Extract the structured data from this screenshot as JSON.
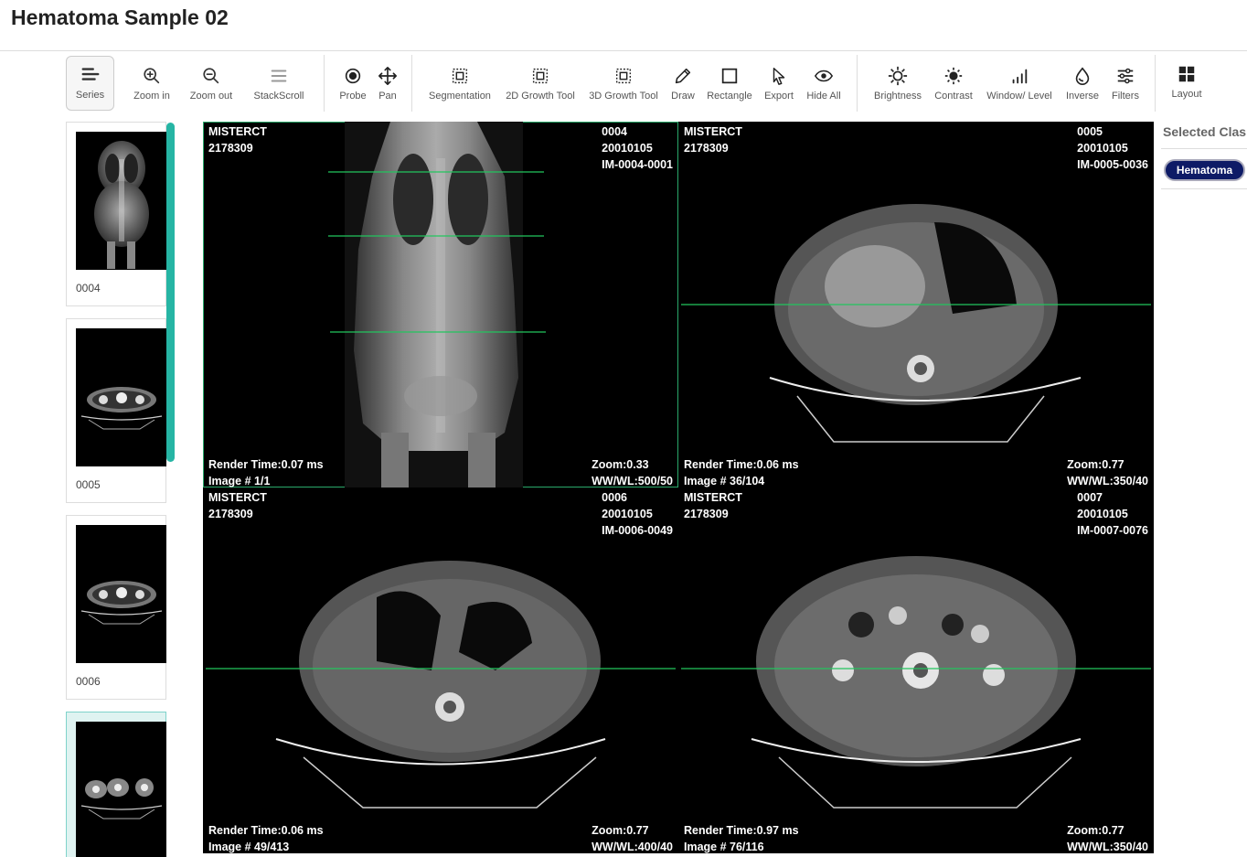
{
  "page": {
    "title": "Hematoma Sample 02"
  },
  "toolbar": {
    "series": "Series",
    "zoom_in": "Zoom in",
    "zoom_out": "Zoom out",
    "stackscroll": "StackScroll",
    "probe": "Probe",
    "pan": "Pan",
    "segmentation": "Segmentation",
    "growth_2d": "2D Growth Tool",
    "growth_3d": "3D Growth Tool",
    "draw": "Draw",
    "rectangle": "Rectangle",
    "export": "Export",
    "hide_all": "Hide All",
    "brightness": "Brightness",
    "contrast": "Contrast",
    "window_level": "Window/ Level",
    "inverse": "Inverse",
    "filters": "Filters",
    "layout": "Layout"
  },
  "thumbnails": [
    {
      "label": "0004",
      "active": false
    },
    {
      "label": "0005",
      "active": false
    },
    {
      "label": "0006",
      "active": false
    },
    {
      "label": "",
      "active": true
    }
  ],
  "viewports": [
    {
      "name": "MISTERCT",
      "id": "2178309",
      "series": "0004",
      "date": "20010105",
      "image_id": "IM-0004-0001",
      "render": "Render Time:0.07 ms",
      "image_num": "Image # 1/1",
      "zoom": "Zoom:0.33",
      "wwwl": "WW/WL:500/50"
    },
    {
      "name": "MISTERCT",
      "id": "2178309",
      "series": "0005",
      "date": "20010105",
      "image_id": "IM-0005-0036",
      "render": "Render Time:0.06 ms",
      "image_num": "Image # 36/104",
      "zoom": "Zoom:0.77",
      "wwwl": "WW/WL:350/40"
    },
    {
      "name": "MISTERCT",
      "id": "2178309",
      "series": "0006",
      "date": "20010105",
      "image_id": "IM-0006-0049",
      "render": "Render Time:0.06 ms",
      "image_num": "Image # 49/413",
      "zoom": "Zoom:0.77",
      "wwwl": "WW/WL:400/40"
    },
    {
      "name": "MISTERCT",
      "id": "2178309",
      "series": "0007",
      "date": "20010105",
      "image_id": "IM-0007-0076",
      "render": "Render Time:0.97 ms",
      "image_num": "Image # 76/116",
      "zoom": "Zoom:0.77",
      "wwwl": "WW/WL:350/40"
    }
  ],
  "right_panel": {
    "title": "Selected Clas",
    "class_chip": "Hematoma"
  },
  "colors": {
    "accent": "#26b5a4",
    "reference_line": "#22c55e",
    "chip": "#0e1b66"
  }
}
